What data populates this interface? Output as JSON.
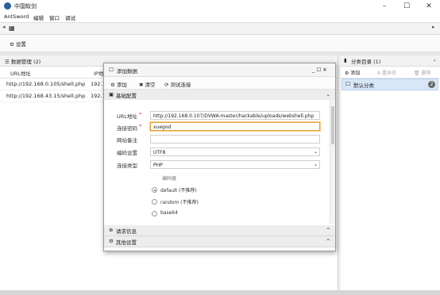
{
  "window": {
    "title": "中国蚁剑",
    "minimize": "–",
    "maximize": "☐",
    "close": "✕"
  },
  "menu": [
    "AntSword",
    "编辑",
    "窗口",
    "调试"
  ],
  "tabs": {
    "left_arrow": "◂",
    "icon": "▦",
    "right_arrow": "▸"
  },
  "toolbar": {
    "settings_icon": "⚙",
    "settings": "设置"
  },
  "data_panel": {
    "title_icon": "☰",
    "title": "数据管理 (2)",
    "columns": [
      "URL地址",
      "IP地"
    ],
    "rows": [
      {
        "url": "http://192.168.0.105/shell.php",
        "ip": "192.1"
      },
      {
        "url": "http://192.168.43.15/shell.php",
        "ip": "192.1"
      }
    ]
  },
  "category_panel": {
    "title_icon": "▮",
    "title": "分类目录 (1)",
    "expand": "›",
    "add_icon": "⚙",
    "add": "添加",
    "rename_icon": "A",
    "rename": "重命名",
    "delete_icon": "🗑",
    "delete": "删除",
    "items": [
      {
        "icon": "☐",
        "name": "默认分类",
        "count": "2"
      }
    ]
  },
  "dialog": {
    "title_icon": "☐",
    "title": "添加数据",
    "win_controls": "_ ☐ ✕",
    "toolbar": {
      "add_icon": "⚙",
      "add": "添加",
      "clear_icon": "✖",
      "clear": "清空",
      "test_icon": "⟳",
      "test": "测试连接"
    },
    "section_basic": {
      "icon": "▣",
      "title": "基础配置",
      "caret": "⌄"
    },
    "form": {
      "url_label": "URL地址",
      "url_required": "*",
      "url_value": "http://192.168.0.107/DVWA-master/hackable/uploads/webshell.php",
      "password_label": "连接密码",
      "password_required": "*",
      "password_value": "xuegod",
      "note_label": "网站备注",
      "note_value": "",
      "encoding_label": "编码设置",
      "encoding_value": "UTF8",
      "type_label": "连接类型",
      "type_value": "PHP",
      "encoder_title": "编码器",
      "encoders": [
        "default (不推荐)",
        "random (不推荐)",
        "base64"
      ],
      "select_chevron": "⌄"
    },
    "section_request": {
      "icon": "⊕",
      "title": "请求信息",
      "caret": "^"
    },
    "section_other": {
      "icon": "⚙",
      "title": "其他设置",
      "caret": "^"
    }
  }
}
